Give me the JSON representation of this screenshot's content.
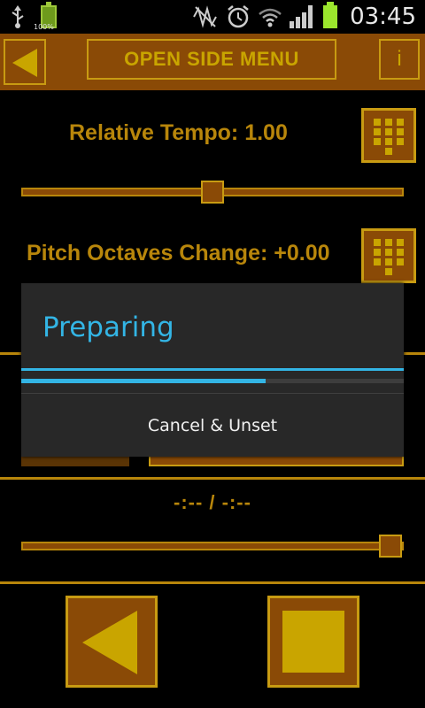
{
  "status_bar": {
    "time": "03:45",
    "battery_small_pct": "100%",
    "icons": [
      "usb-icon",
      "battery-icon",
      "mute-icon",
      "alarm-icon",
      "wifi-icon",
      "signal-icon",
      "battery-icon"
    ]
  },
  "toolbar": {
    "open_side_menu_label": "OPEN SIDE MENU",
    "info_label": "i"
  },
  "controls": {
    "tempo_label": "Relative Tempo: 1.00",
    "tempo_slider_fraction": 0.5,
    "pitch_label": "Pitch Octaves Change: +0.00",
    "time_display": "-:-- / -:--",
    "position_slider_fraction": 1.0
  },
  "dialog": {
    "title": "Preparing",
    "progress_fraction": 0.64,
    "cancel_button_label": "Cancel & Unset"
  },
  "colors": {
    "accent_brown": "#8a4a06",
    "accent_gold": "#c9a500",
    "dialog_blue": "#33b5e5"
  }
}
